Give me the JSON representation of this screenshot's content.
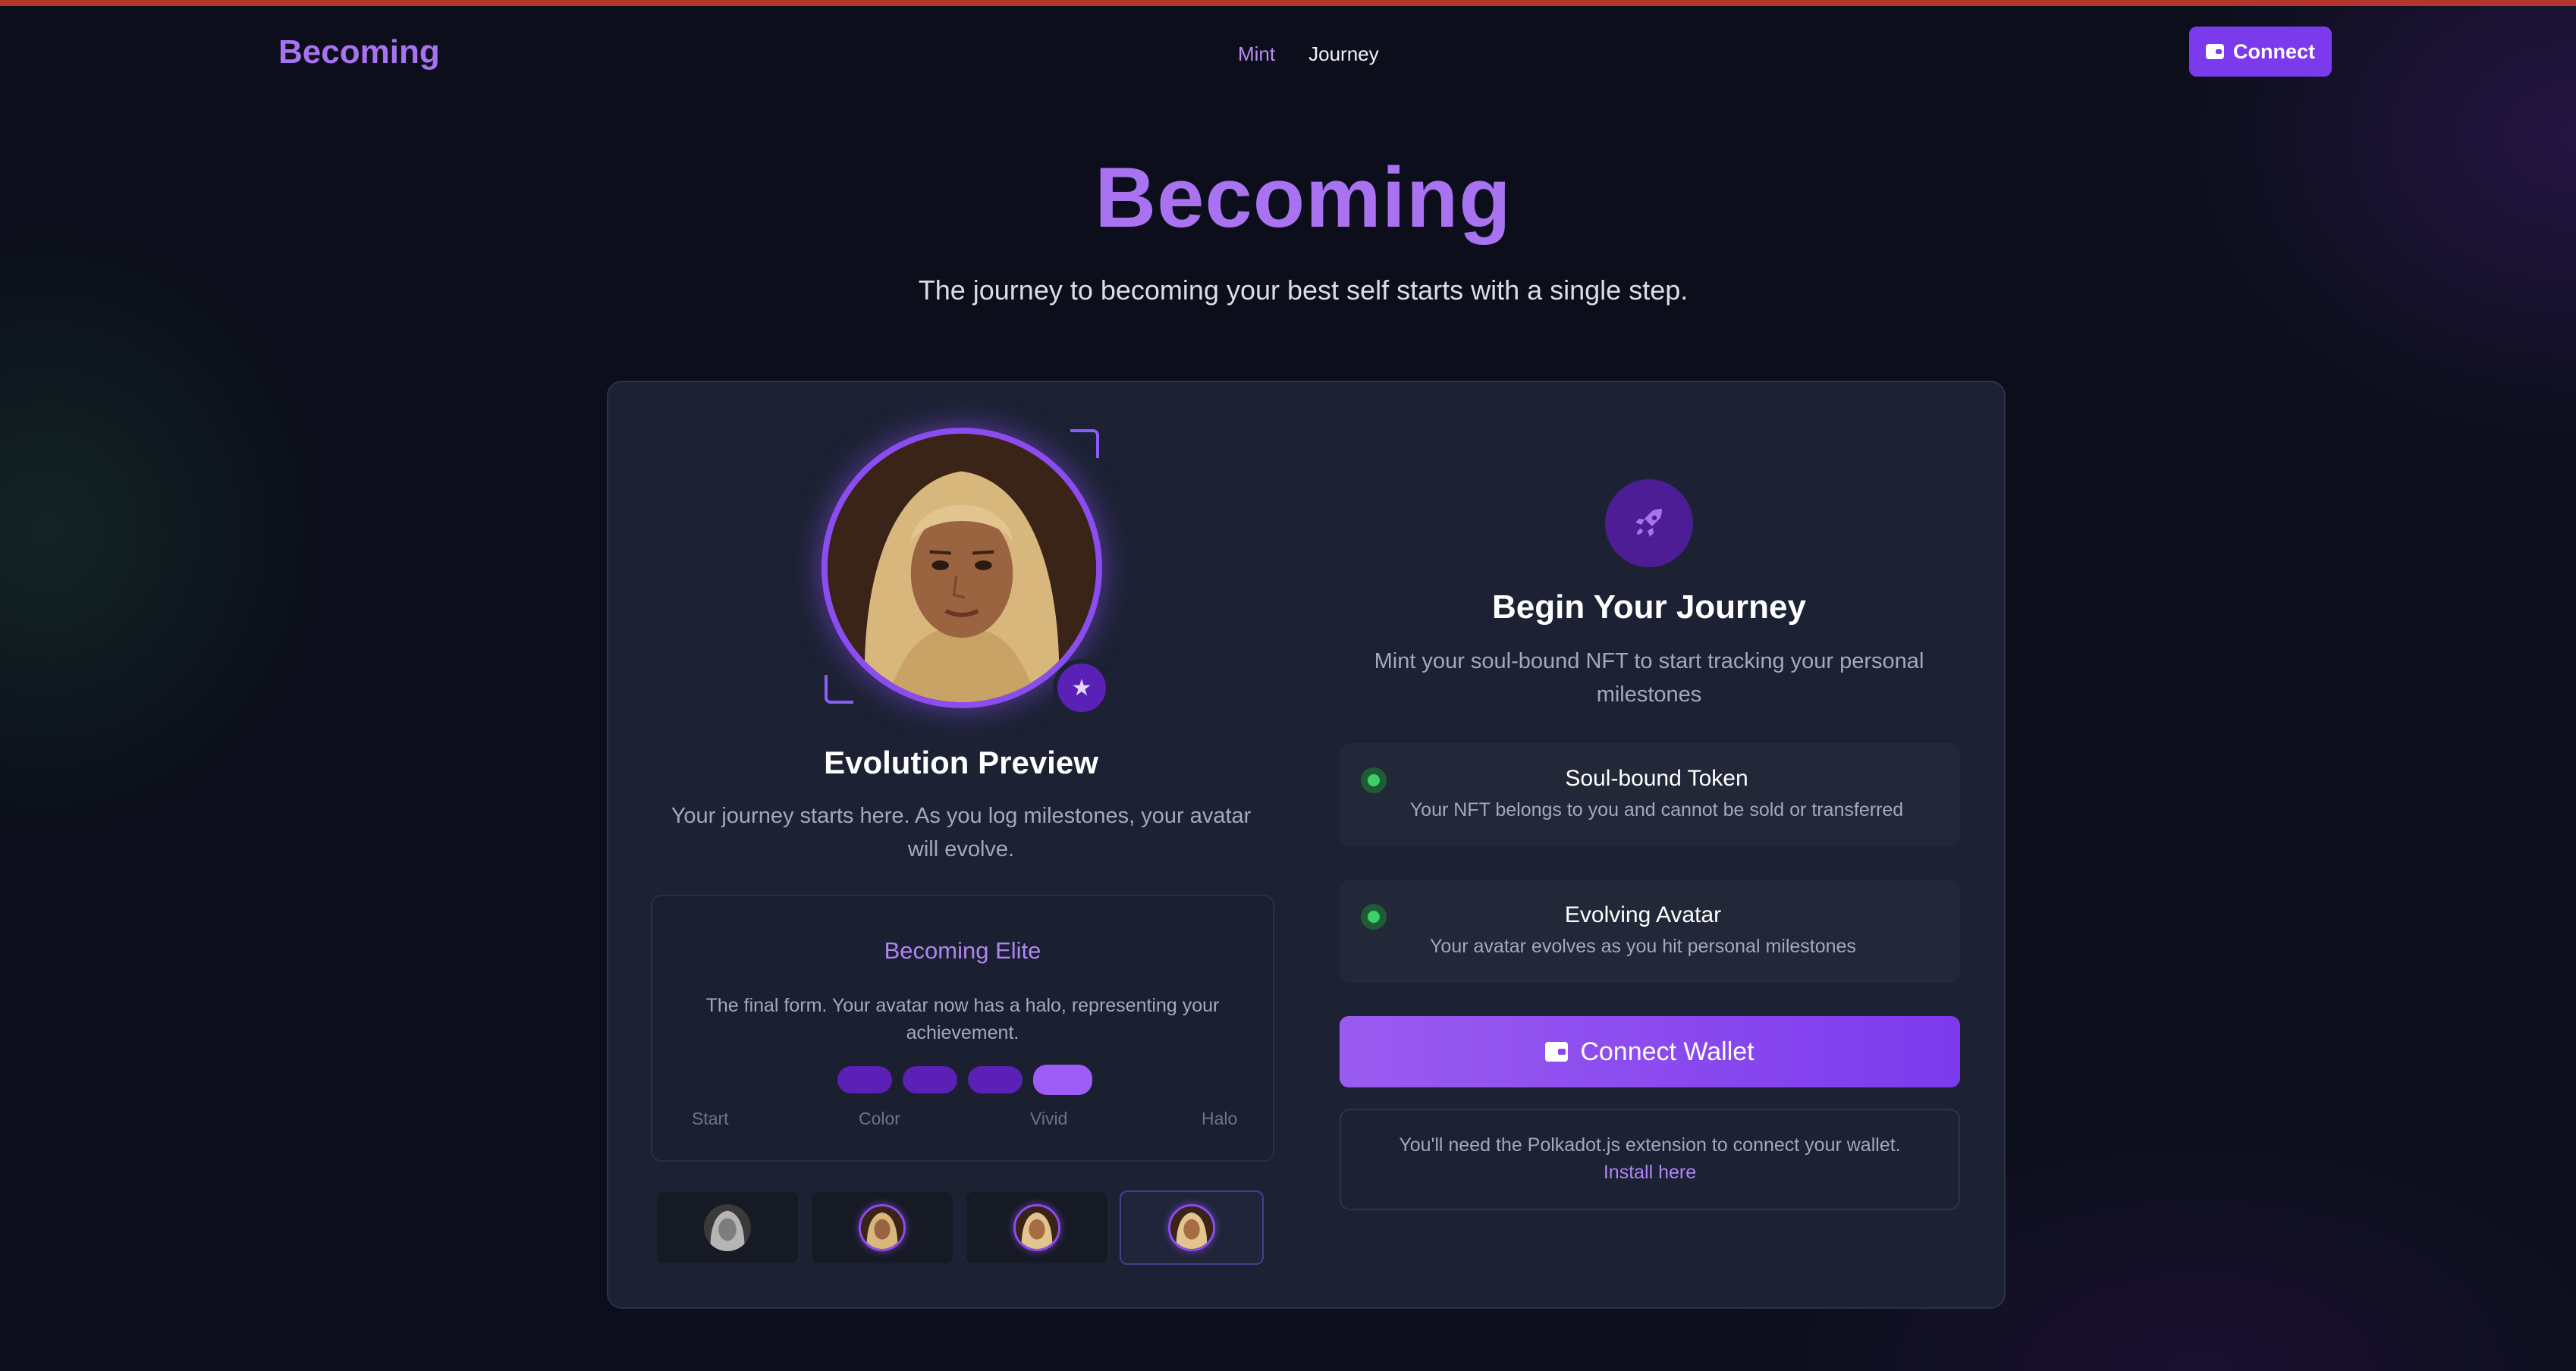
{
  "nav": {
    "brand": "Becoming",
    "links": [
      {
        "label": "Mint",
        "active": true
      },
      {
        "label": "Journey",
        "active": false
      }
    ],
    "connect_label": "Connect"
  },
  "hero": {
    "title": "Becoming",
    "subtitle": "The journey to becoming your best self starts with a single step."
  },
  "preview": {
    "title": "Evolution Preview",
    "description": "Your journey starts here. As you log milestones, your avatar will evolve.",
    "stage": {
      "name": "Becoming Elite",
      "description": "The final form. Your avatar now has a halo, representing your achievement.",
      "progress": {
        "current_step": 4,
        "total_steps": 4
      },
      "labels": [
        "Start",
        "Color",
        "Vivid",
        "Halo"
      ]
    },
    "thumbnails": [
      {
        "name": "stage-start",
        "selected": false
      },
      {
        "name": "stage-color",
        "selected": false
      },
      {
        "name": "stage-vivid",
        "selected": false
      },
      {
        "name": "stage-halo",
        "selected": true
      }
    ]
  },
  "journey": {
    "icon": "rocket-icon",
    "title": "Begin Your Journey",
    "description": "Mint your soul-bound NFT to start tracking your personal milestones",
    "features": [
      {
        "title": "Soul-bound Token",
        "description": "Your NFT belongs to you and cannot be sold or transferred"
      },
      {
        "title": "Evolving Avatar",
        "description": "Your avatar evolves as you hit personal milestones"
      }
    ],
    "wallet_button": "Connect Wallet",
    "note_prefix": "You'll need the Polkadot.js extension to connect your wallet.",
    "note_link": "Install here"
  },
  "colors": {
    "accent": "#7c3aed",
    "brand_text": "#a872f0",
    "background": "#0c0f1b",
    "card": "#1c2233",
    "success_dot": "#3ccf6a"
  }
}
